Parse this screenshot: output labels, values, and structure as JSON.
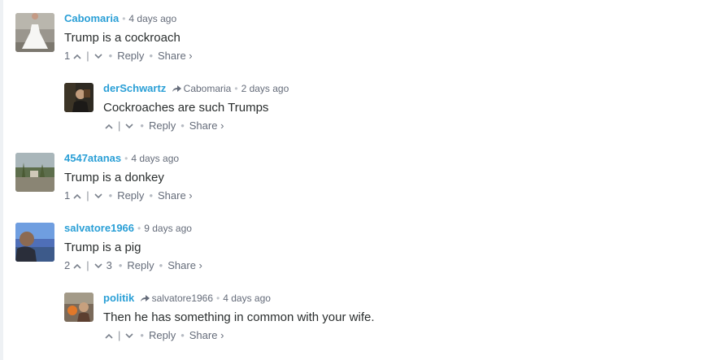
{
  "comments": [
    {
      "author": "Cabomaria",
      "time": "4 days ago",
      "text": "Trump is a cockroach",
      "upvotes": "1",
      "downvotes": "",
      "reply_label": "Reply",
      "share_label": "Share ›"
    },
    {
      "author": "derSchwartz",
      "parent": "Cabomaria",
      "time": "2 days ago",
      "text": "Cockroaches are such Trumps",
      "upvotes": "",
      "downvotes": "",
      "reply_label": "Reply",
      "share_label": "Share ›"
    },
    {
      "author": "4547atanas",
      "time": "4 days ago",
      "text": "Trump is a donkey",
      "upvotes": "1",
      "downvotes": "",
      "reply_label": "Reply",
      "share_label": "Share ›"
    },
    {
      "author": "salvatore1966",
      "time": "9 days ago",
      "text": "Trump is a pig",
      "upvotes": "2",
      "downvotes": "3",
      "reply_label": "Reply",
      "share_label": "Share ›"
    },
    {
      "author": "politik",
      "parent": "salvatore1966",
      "time": "4 days ago",
      "text": "Then he has something in common with your wife.",
      "upvotes": "",
      "downvotes": "",
      "reply_label": "Reply",
      "share_label": "Share ›"
    }
  ],
  "separators": {
    "bullet": "•",
    "pipe": "|"
  },
  "colors": {
    "author": "#2a9fd6",
    "meta": "#656c7a",
    "text": "#2a2e2e"
  },
  "icons": {
    "upvote": "chevron-up-icon",
    "downvote": "chevron-down-icon",
    "reply_to": "reply-arrow-icon"
  }
}
